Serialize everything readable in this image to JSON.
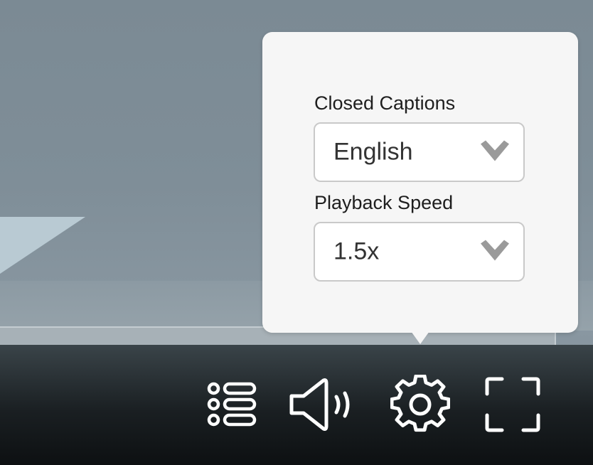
{
  "settings_popup": {
    "captions": {
      "label": "Closed Captions",
      "selected": "English"
    },
    "speed": {
      "label": "Playback Speed",
      "selected": "1.5x"
    }
  },
  "controls": {
    "icons": [
      "playlist-icon",
      "volume-icon",
      "gear-icon",
      "fullscreen-icon"
    ]
  },
  "colors": {
    "popup_bg": "#f6f6f6",
    "control_bar": "#1a1f22",
    "icon": "#ffffff",
    "chevron": "#9a9a9a"
  }
}
